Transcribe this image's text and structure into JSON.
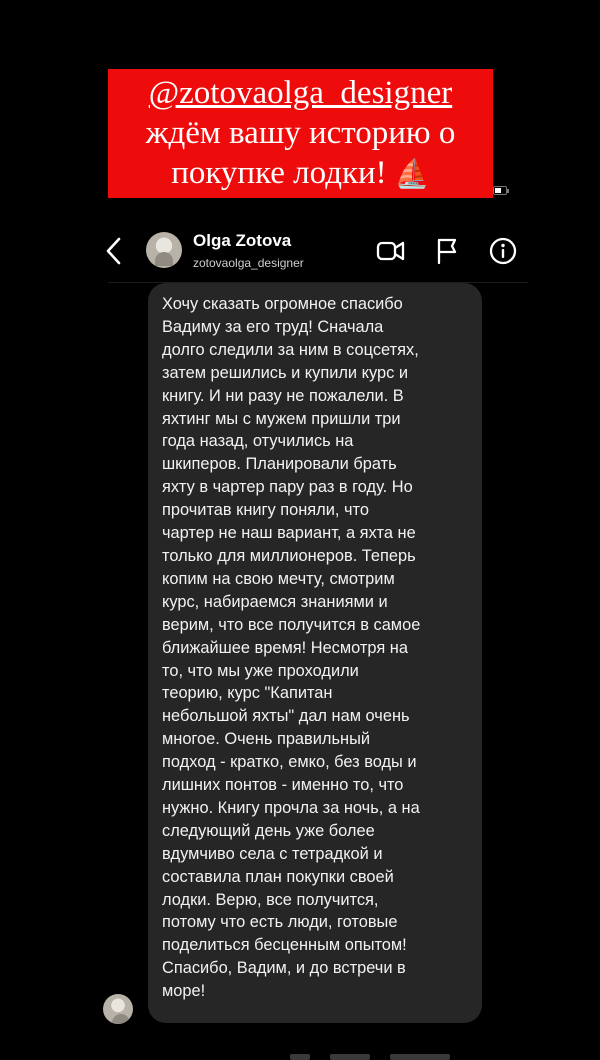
{
  "banner": {
    "handle": "@zotovaolga_designer",
    "line1": "ждём вашу историю о",
    "line2": "покупке лодки!",
    "emoji": "⛵"
  },
  "header": {
    "name": "Olga Zotova",
    "username": "zotovaolga_designer",
    "icons": [
      "back-chevron-icon",
      "video-call-icon",
      "flag-icon",
      "info-icon"
    ]
  },
  "message": {
    "text": "Хочу сказать огромное спасибо\nВадиму за его труд! Сначала\nдолго следили за ним в соцсетях,\nзатем решились и купили курс и\nкнигу. И ни разу не пожалели. В\nяхтинг мы с мужем пришли три\nгода назад, отучились на\nшкиперов. Планировали брать\nяхту в чартер пару раз в году. Но\nпрочитав книгу поняли, что\nчартер не наш вариант, а яхта не\nтолько для миллионеров. Теперь\nкопим на свою мечту, смотрим\nкурс, набираемся знаниями и\nверим, что все получится в самое\nближайшее время! Несмотря на\nто, что мы уже проходили\nтеорию, курс \"Капитан\nнебольшой яхты\" дал нам очень\nмногое. Очень правильный\nподход - кратко, емко, без воды и\nлишних понтов - именно то, что\nнужно. Книгу прочла за ночь, а на\nследующий день уже более\nвдумчиво села с тетрадкой и\nсоставила план покупки своей\nлодки. Верю, все получится,\nпотому что есть люди, готовые\nподелиться бесценным опытом!\nСпасибо, Вадим, и до встречи в\nморе!"
  },
  "colors": {
    "background": "#000000",
    "banner": "#ee0b0b",
    "bubble": "#262626"
  }
}
